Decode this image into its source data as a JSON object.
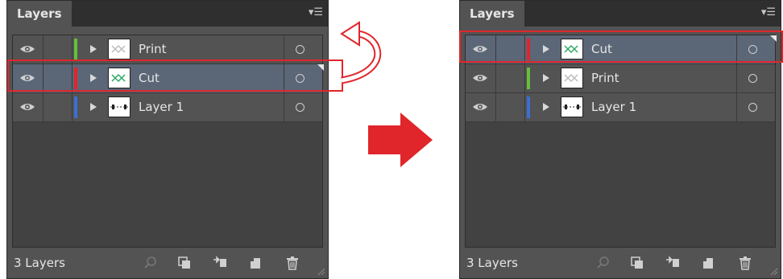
{
  "colors": {
    "accent_red": "#e0262b",
    "print_color": "#64c03c",
    "cut_color": "#e0262b",
    "layer1_color": "#3a6fd3",
    "selected_row": "#5b6677",
    "panel_bg": "#535353"
  },
  "icons": {
    "panel_menu": "flyout-menu-icon",
    "visibility": "eye-icon",
    "expand": "disclosure-triangle-icon",
    "target": "target-circle-icon",
    "footer": [
      "locate-object-icon",
      "make-clipping-mask-icon",
      "create-sublayer-icon",
      "create-new-layer-icon",
      "trash-icon"
    ]
  },
  "before_panel": {
    "tab_label": "Layers",
    "menu_glyph": "▾☰",
    "layers": [
      {
        "name": "Print",
        "selected": false
      },
      {
        "name": "Cut",
        "selected": true
      },
      {
        "name": "Layer 1",
        "selected": false
      }
    ],
    "count_label": "3 Layers"
  },
  "after_panel": {
    "tab_label": "Layers",
    "menu_glyph": "▾☰",
    "layers": [
      {
        "name": "Cut",
        "selected": true
      },
      {
        "name": "Print",
        "selected": false
      },
      {
        "name": "Layer 1",
        "selected": false
      }
    ],
    "count_label": "3 Layers"
  }
}
